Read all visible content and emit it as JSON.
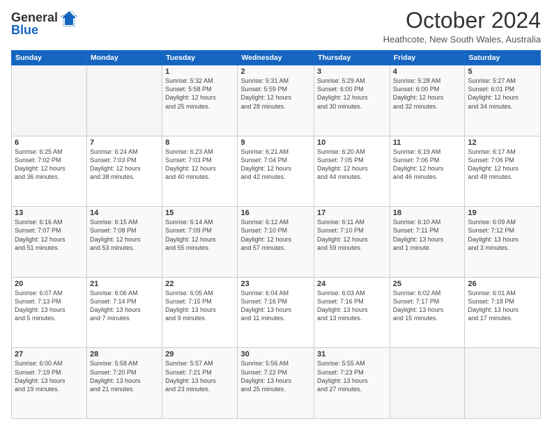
{
  "header": {
    "logo_line1": "General",
    "logo_line2": "Blue",
    "title": "October 2024",
    "subtitle": "Heathcote, New South Wales, Australia"
  },
  "weekdays": [
    "Sunday",
    "Monday",
    "Tuesday",
    "Wednesday",
    "Thursday",
    "Friday",
    "Saturday"
  ],
  "weeks": [
    [
      {
        "day": "",
        "detail": ""
      },
      {
        "day": "",
        "detail": ""
      },
      {
        "day": "1",
        "detail": "Sunrise: 5:32 AM\nSunset: 5:58 PM\nDaylight: 12 hours\nand 25 minutes."
      },
      {
        "day": "2",
        "detail": "Sunrise: 5:31 AM\nSunset: 5:59 PM\nDaylight: 12 hours\nand 28 minutes."
      },
      {
        "day": "3",
        "detail": "Sunrise: 5:29 AM\nSunset: 6:00 PM\nDaylight: 12 hours\nand 30 minutes."
      },
      {
        "day": "4",
        "detail": "Sunrise: 5:28 AM\nSunset: 6:00 PM\nDaylight: 12 hours\nand 32 minutes."
      },
      {
        "day": "5",
        "detail": "Sunrise: 5:27 AM\nSunset: 6:01 PM\nDaylight: 12 hours\nand 34 minutes."
      }
    ],
    [
      {
        "day": "6",
        "detail": "Sunrise: 6:25 AM\nSunset: 7:02 PM\nDaylight: 12 hours\nand 36 minutes."
      },
      {
        "day": "7",
        "detail": "Sunrise: 6:24 AM\nSunset: 7:03 PM\nDaylight: 12 hours\nand 38 minutes."
      },
      {
        "day": "8",
        "detail": "Sunrise: 6:23 AM\nSunset: 7:03 PM\nDaylight: 12 hours\nand 40 minutes."
      },
      {
        "day": "9",
        "detail": "Sunrise: 6:21 AM\nSunset: 7:04 PM\nDaylight: 12 hours\nand 42 minutes."
      },
      {
        "day": "10",
        "detail": "Sunrise: 6:20 AM\nSunset: 7:05 PM\nDaylight: 12 hours\nand 44 minutes."
      },
      {
        "day": "11",
        "detail": "Sunrise: 6:19 AM\nSunset: 7:06 PM\nDaylight: 12 hours\nand 46 minutes."
      },
      {
        "day": "12",
        "detail": "Sunrise: 6:17 AM\nSunset: 7:06 PM\nDaylight: 12 hours\nand 49 minutes."
      }
    ],
    [
      {
        "day": "13",
        "detail": "Sunrise: 6:16 AM\nSunset: 7:07 PM\nDaylight: 12 hours\nand 51 minutes."
      },
      {
        "day": "14",
        "detail": "Sunrise: 6:15 AM\nSunset: 7:08 PM\nDaylight: 12 hours\nand 53 minutes."
      },
      {
        "day": "15",
        "detail": "Sunrise: 6:14 AM\nSunset: 7:09 PM\nDaylight: 12 hours\nand 55 minutes."
      },
      {
        "day": "16",
        "detail": "Sunrise: 6:12 AM\nSunset: 7:10 PM\nDaylight: 12 hours\nand 57 minutes."
      },
      {
        "day": "17",
        "detail": "Sunrise: 6:11 AM\nSunset: 7:10 PM\nDaylight: 12 hours\nand 59 minutes."
      },
      {
        "day": "18",
        "detail": "Sunrise: 6:10 AM\nSunset: 7:11 PM\nDaylight: 13 hours\nand 1 minute."
      },
      {
        "day": "19",
        "detail": "Sunrise: 6:09 AM\nSunset: 7:12 PM\nDaylight: 13 hours\nand 3 minutes."
      }
    ],
    [
      {
        "day": "20",
        "detail": "Sunrise: 6:07 AM\nSunset: 7:13 PM\nDaylight: 13 hours\nand 5 minutes."
      },
      {
        "day": "21",
        "detail": "Sunrise: 6:06 AM\nSunset: 7:14 PM\nDaylight: 13 hours\nand 7 minutes."
      },
      {
        "day": "22",
        "detail": "Sunrise: 6:05 AM\nSunset: 7:15 PM\nDaylight: 13 hours\nand 9 minutes."
      },
      {
        "day": "23",
        "detail": "Sunrise: 6:04 AM\nSunset: 7:16 PM\nDaylight: 13 hours\nand 11 minutes."
      },
      {
        "day": "24",
        "detail": "Sunrise: 6:03 AM\nSunset: 7:16 PM\nDaylight: 13 hours\nand 13 minutes."
      },
      {
        "day": "25",
        "detail": "Sunrise: 6:02 AM\nSunset: 7:17 PM\nDaylight: 13 hours\nand 15 minutes."
      },
      {
        "day": "26",
        "detail": "Sunrise: 6:01 AM\nSunset: 7:18 PM\nDaylight: 13 hours\nand 17 minutes."
      }
    ],
    [
      {
        "day": "27",
        "detail": "Sunrise: 6:00 AM\nSunset: 7:19 PM\nDaylight: 13 hours\nand 19 minutes."
      },
      {
        "day": "28",
        "detail": "Sunrise: 5:58 AM\nSunset: 7:20 PM\nDaylight: 13 hours\nand 21 minutes."
      },
      {
        "day": "29",
        "detail": "Sunrise: 5:57 AM\nSunset: 7:21 PM\nDaylight: 13 hours\nand 23 minutes."
      },
      {
        "day": "30",
        "detail": "Sunrise: 5:56 AM\nSunset: 7:22 PM\nDaylight: 13 hours\nand 25 minutes."
      },
      {
        "day": "31",
        "detail": "Sunrise: 5:55 AM\nSunset: 7:23 PM\nDaylight: 13 hours\nand 27 minutes."
      },
      {
        "day": "",
        "detail": ""
      },
      {
        "day": "",
        "detail": ""
      }
    ]
  ]
}
